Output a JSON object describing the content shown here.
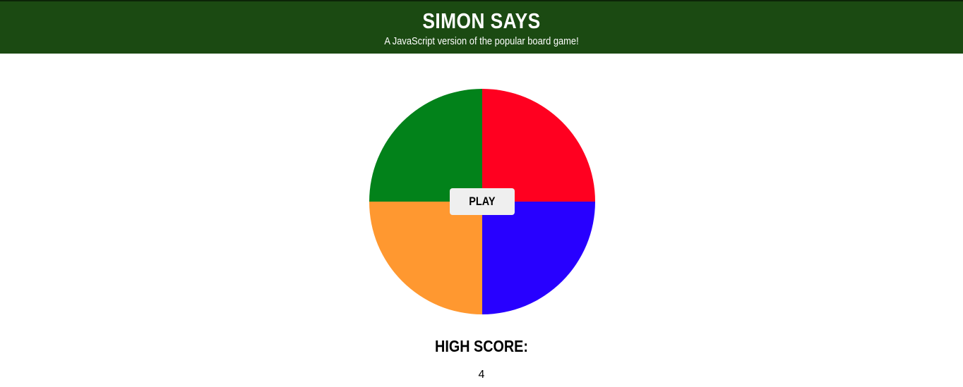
{
  "header": {
    "title": "SIMON SAYS",
    "subtitle": "A JavaScript version of the popular board game!",
    "background_color": "#1b4a12"
  },
  "board": {
    "quadrants": [
      {
        "name": "green",
        "color": "#02821a"
      },
      {
        "name": "red",
        "color": "#ff0020"
      },
      {
        "name": "orange",
        "color": "#ff9830"
      },
      {
        "name": "blue",
        "color": "#2800ff"
      }
    ],
    "play_label": "PLAY"
  },
  "score": {
    "label": "HIGH SCORE:",
    "value": "4"
  }
}
